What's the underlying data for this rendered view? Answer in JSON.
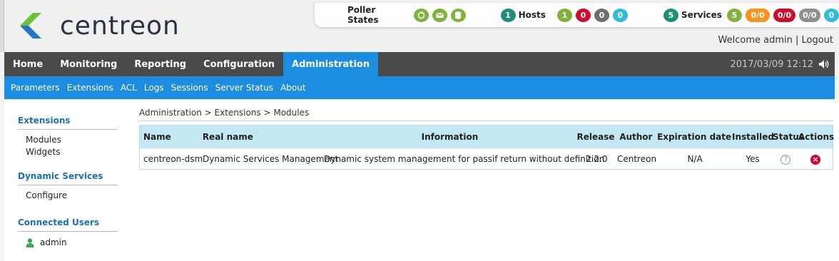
{
  "brand": {
    "name": "centreon",
    "colors": {
      "accent": "#1c8ce0",
      "dark_nav": "#4a4a4a",
      "logo_green": "#6fbf39",
      "logo_blue": "#2276c8"
    }
  },
  "poller": {
    "label": "Poller States",
    "icons": [
      "refresh-icon",
      "mail-icon",
      "database-icon"
    ]
  },
  "hosts": {
    "count": "1",
    "label": "Hosts",
    "up": "1",
    "down": "0",
    "unreachable": "0",
    "pending": "0"
  },
  "services": {
    "count": "5",
    "label": "Services",
    "ok": "5",
    "warning": "0/0",
    "critical": "0/0",
    "unknown": "0/0",
    "pending": "0"
  },
  "user": {
    "welcome": "Welcome admin | Logout"
  },
  "main_nav": {
    "items": [
      {
        "label": "Home"
      },
      {
        "label": "Monitoring"
      },
      {
        "label": "Reporting"
      },
      {
        "label": "Configuration"
      },
      {
        "label": "Administration",
        "active": true
      }
    ],
    "datetime": "2017/03/09 12:12"
  },
  "sub_nav": {
    "items": [
      {
        "label": "Parameters"
      },
      {
        "label": "Extensions"
      },
      {
        "label": "ACL"
      },
      {
        "label": "Logs"
      },
      {
        "label": "Sessions"
      },
      {
        "label": "Server Status"
      },
      {
        "label": "About"
      }
    ]
  },
  "sidebar": {
    "extensions_title": "Extensions",
    "modules": "Modules",
    "widgets": "Widgets",
    "dynamic_title": "Dynamic Services",
    "configure": "Configure",
    "connected_title": "Connected Users",
    "admin": "admin"
  },
  "breadcrumb": "Administration > Extensions > Modules",
  "table": {
    "headers": [
      "Name",
      "Real name",
      "Information",
      "Release",
      "Author",
      "Expiration date",
      "Installed",
      "Status",
      "Actions"
    ],
    "rows": [
      [
        "centreon-dsm",
        "Dynamic Services Management",
        "Dynamic system management for passif return without definition",
        "2.2.0",
        "Centreon",
        "N/A",
        "Yes"
      ]
    ]
  }
}
